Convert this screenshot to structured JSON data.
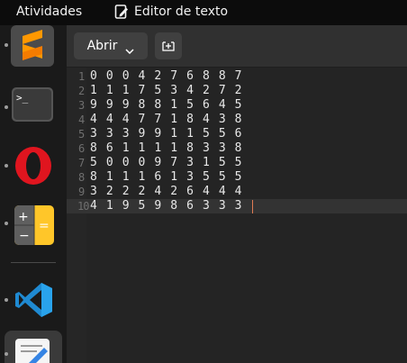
{
  "topbar": {
    "activities_label": "Atividades",
    "app_name": "Editor de texto",
    "app_icon": "text-editor-icon"
  },
  "dock": {
    "items": [
      {
        "name": "Sublime Text",
        "icon": "sublime-text-icon",
        "running": true
      },
      {
        "name": "Terminal",
        "icon": "terminal-icon",
        "running": true
      },
      {
        "name": "Opera",
        "icon": "opera-icon",
        "running": true
      },
      {
        "name": "Calculadora",
        "icon": "calculator-icon",
        "running": true
      },
      {
        "name": "Visual Studio Code",
        "icon": "vscode-icon",
        "running": true
      },
      {
        "name": "Editor de texto",
        "icon": "text-editor-icon",
        "running": true,
        "active": true
      }
    ]
  },
  "headerbar": {
    "open_label": "Abrir",
    "open_icon": "chevron-down-icon",
    "new_tab_icon": "new-tab-icon"
  },
  "editor": {
    "lines": [
      {
        "number": "1",
        "text": "0 0 0 4 2 7 6 8 8 7"
      },
      {
        "number": "2",
        "text": "1 1 1 7 5 3 4 2 7 2"
      },
      {
        "number": "3",
        "text": "9 9 9 8 8 1 5 6 4 5"
      },
      {
        "number": "4",
        "text": "4 4 4 7 7 1 8 4 3 8"
      },
      {
        "number": "5",
        "text": "3 3 3 9 9 1 1 5 5 6"
      },
      {
        "number": "6",
        "text": "8 6 1 1 1 1 8 3 3 8"
      },
      {
        "number": "7",
        "text": "5 0 0 0 9 7 3 1 5 5"
      },
      {
        "number": "8",
        "text": "8 1 1 1 6 1 3 5 5 5"
      },
      {
        "number": "9",
        "text": "3 2 2 2 4 2 6 4 4 4"
      },
      {
        "number": "10",
        "text": "4 1 9 5 9 8 6 3 3 3"
      }
    ],
    "current_line": 10,
    "colors": {
      "caret": "#e07b53",
      "background": "#242424",
      "text": "#e8e8e8"
    }
  }
}
